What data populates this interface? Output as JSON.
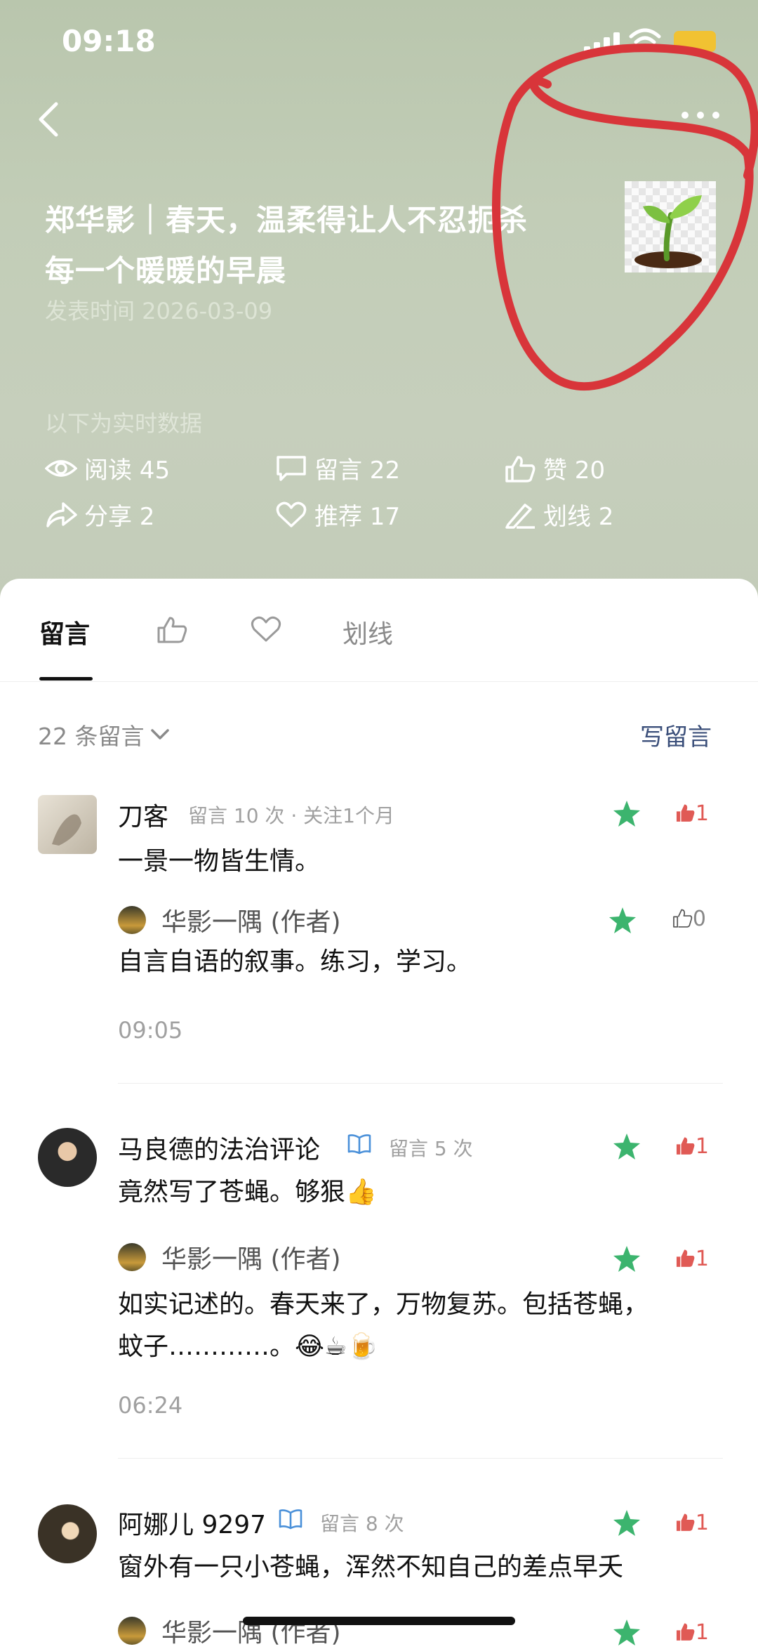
{
  "status_bar": {
    "time": "09:18"
  },
  "article": {
    "title_line1": "郑华影｜春天，温柔得让人不忍扼杀",
    "title_line2": "每一个暖暖的早晨",
    "published": "发表时间 2026-03-09",
    "realtime_note": "以下为实时数据",
    "thumbnail_icon": "seedling-icon"
  },
  "stats": {
    "read": "阅读 45",
    "comments": "留言 22",
    "likes": "赞 20",
    "share": "分享 2",
    "recommend": "推荐 17",
    "highlight": "划线 2"
  },
  "tabs": {
    "comments": "留言",
    "highlights": "划线"
  },
  "comments_header": {
    "count": "22 条留言",
    "write": "写留言"
  },
  "comments": [
    {
      "name": "刀客",
      "meta": "留言 10 次 · 关注1个月",
      "text": "一景一物皆生情。",
      "likes": "1",
      "reply": {
        "name": "华影一隅 (作者)",
        "text": "自言自语的叙事。练习，学习。",
        "likes": "0"
      },
      "time": "09:05"
    },
    {
      "name": "马良德的法治评论",
      "meta": "留言 5 次",
      "text": "竟然写了苍蝇。够狠👍",
      "likes": "1",
      "reply": {
        "name": "华影一隅 (作者)",
        "text_line1": "如实记述的。春天来了，万物复苏。包括苍蝇，",
        "text_line2": "蚊子…………。😂☕🍺",
        "likes": "1"
      },
      "time": "06:24"
    },
    {
      "name": "阿娜儿 9297",
      "meta": "留言 8 次",
      "text": "窗外有一只小苍蝇，浑然不知自己的差点早夭",
      "likes": "1",
      "reply": {
        "name": "华影一隅 (作者)",
        "likes": "1"
      }
    }
  ],
  "colors": {
    "accent_green": "#3cb46e",
    "like_red": "#e05a55",
    "link_blue": "#3b4f7a",
    "annotation_red": "#d8353a"
  }
}
